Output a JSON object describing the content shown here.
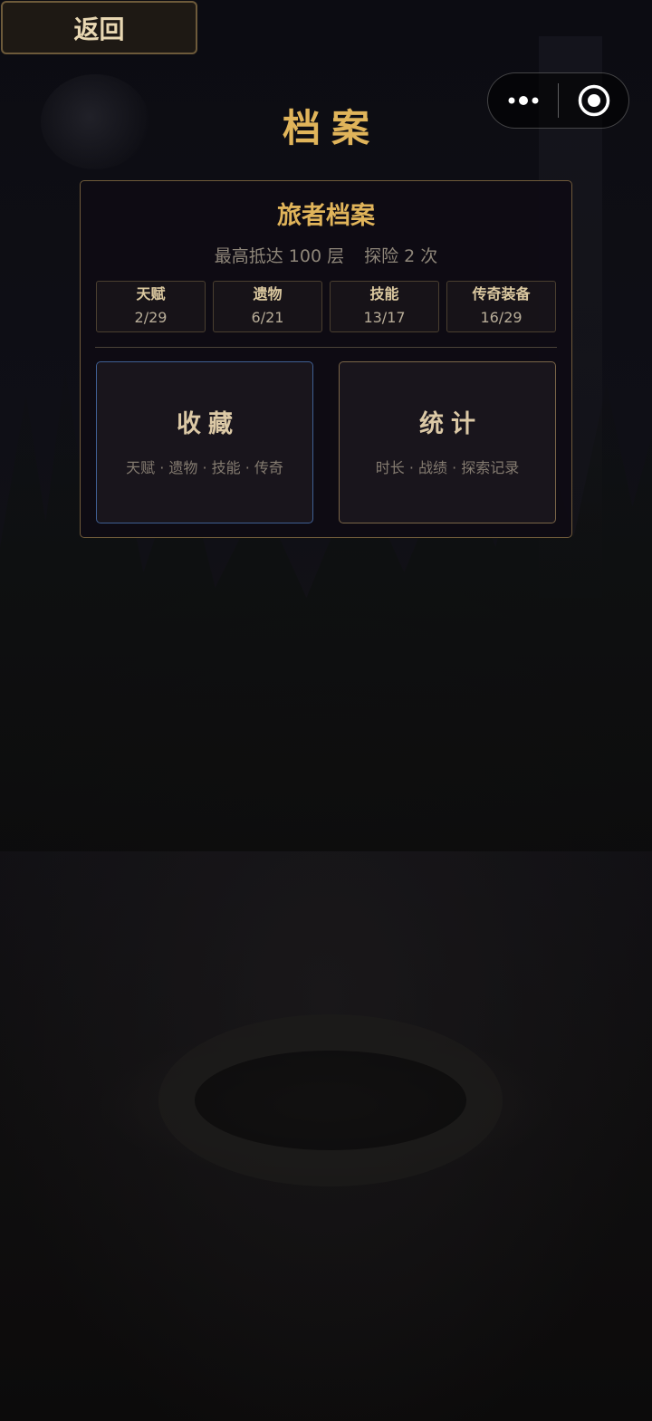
{
  "header": {
    "back_label": "返回",
    "title": "档案"
  },
  "capsule": {
    "more_icon": "more-dots-icon",
    "close_icon": "target-close-icon"
  },
  "card": {
    "title": "旅者档案",
    "summary": {
      "max_floor": "最高抵达 100 层",
      "explore_count": "探险 2 次"
    },
    "stats": [
      {
        "label": "天赋",
        "value": "2/29"
      },
      {
        "label": "遗物",
        "value": "6/21"
      },
      {
        "label": "技能",
        "value": "13/17"
      },
      {
        "label": "传奇装备",
        "value": "16/29"
      }
    ],
    "buttons": {
      "collection": {
        "title": "收藏",
        "desc": "天赋 · 遗物 · 技能 · 传奇"
      },
      "statistics": {
        "title": "统计",
        "desc": "时长 · 战绩 · 探索记录"
      }
    }
  },
  "colors": {
    "accent_gold": "#e0b45a",
    "collection_border": "#3f5f93",
    "statistics_border": "#7a6548"
  }
}
